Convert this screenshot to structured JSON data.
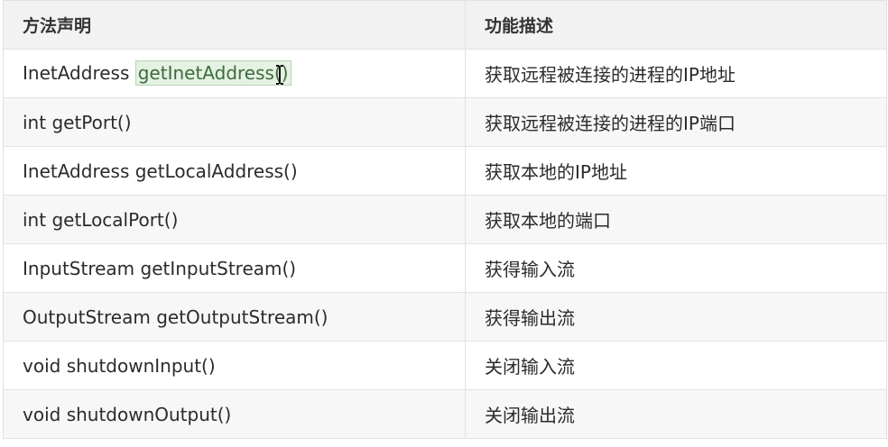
{
  "table": {
    "headers": [
      "方法声明",
      "功能描述"
    ],
    "rows": [
      {
        "type": "InetAddress",
        "method": "getInetAddress()",
        "desc": "获取远程被连接的进程的IP地址"
      },
      {
        "type": "int",
        "method": "getPort()",
        "desc": "获取远程被连接的进程的IP端口"
      },
      {
        "type": "InetAddress",
        "method": "getLocalAddress()",
        "desc": "获取本地的IP地址"
      },
      {
        "type": "int",
        "method": "getLocalPort()",
        "desc": "获取本地的端口"
      },
      {
        "type": "InputStream",
        "method": "getInputStream()",
        "desc": "获得输入流"
      },
      {
        "type": "OutputStream",
        "method": "getOutputStream()",
        "desc": "获得输出流"
      },
      {
        "type": "void",
        "method": "shutdownInput()",
        "desc": "关闭输入流"
      },
      {
        "type": "void",
        "method": "shutdownOutput()",
        "desc": "关闭输出流"
      }
    ]
  },
  "selection": {
    "highlighted_text": "getInetAddress()"
  },
  "icons": {
    "cursor": "text-cursor-icon"
  },
  "colors": {
    "header_bg": "#f2f2f2",
    "stripe_bg": "#f7f7f7",
    "highlight_bg": "#e4f1e3",
    "border": "#e2e2e2"
  }
}
